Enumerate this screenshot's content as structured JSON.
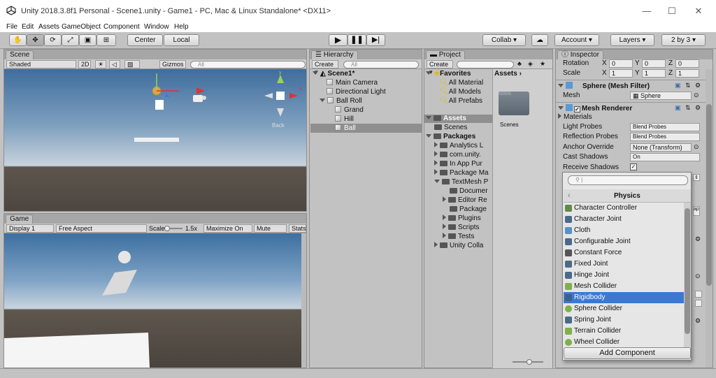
{
  "window": {
    "title": "Unity 2018.3.8f1 Personal - Scene1.unity - Game1 - PC, Mac & Linux Standalone* <DX11>",
    "minimize": "—",
    "maximize": "☐",
    "close": "✕"
  },
  "menu": [
    "File",
    "Edit",
    "Assets",
    "GameObject",
    "Component",
    "Window",
    "Help"
  ],
  "toolbar": {
    "center": "Center",
    "local": "Local",
    "collab": "Collab",
    "account": "Account",
    "layers": "Layers",
    "layout": "2 by 3"
  },
  "scene": {
    "tab": "Scene",
    "shading": "Shaded",
    "mode2d": "2D",
    "gizmos": "Gizmos",
    "search": "All",
    "back_label": "Back"
  },
  "game": {
    "tab": "Game",
    "display": "Display 1",
    "aspect": "Free Aspect",
    "scale_label": "Scale",
    "scale_value": "1.5x",
    "maximize": "Maximize On Play",
    "mute": "Mute Audio",
    "stats": "Stats"
  },
  "hierarchy": {
    "tab": "Hierarchy",
    "create": "Create",
    "search": "All",
    "scene": "Scene1*",
    "items": [
      "Main Camera",
      "Directional Light",
      "Ball Roll",
      "Grand",
      "Hill",
      "Ball"
    ]
  },
  "project": {
    "tab": "Project",
    "create": "Create",
    "favorites": "Favorites",
    "fav_items": [
      "All Material",
      "All Models",
      "All Prefabs"
    ],
    "assets": "Assets",
    "assets_children": [
      "Scenes"
    ],
    "packages": "Packages",
    "packages_children": [
      "Analytics L",
      "com.unity.",
      "In App Pur",
      "Package Ma",
      "TextMesh P"
    ],
    "textmesh_children": [
      "Documer",
      "Editor Re",
      "Package",
      "Plugins",
      "Scripts",
      "Tests"
    ],
    "unity_colla": "Unity Colla",
    "breadcrumb": "Assets",
    "folder_label": "Scenes"
  },
  "inspector": {
    "tab": "Inspector",
    "rotation": "Rotation",
    "scale": "Scale",
    "rot": {
      "x": "0",
      "y": "0",
      "z": "0"
    },
    "scl": {
      "x": "1",
      "y": "1",
      "z": "1"
    },
    "mesh_filter": "Sphere (Mesh Filter)",
    "mesh_label": "Mesh",
    "mesh_value": "Sphere",
    "mesh_renderer": "Mesh Renderer",
    "materials": "Materials",
    "rows": [
      {
        "label": "Light Probes",
        "value": "Blend Probes"
      },
      {
        "label": "Reflection Probes",
        "value": "Blend Probes"
      },
      {
        "label": "Anchor Override",
        "value": "None (Transform)"
      },
      {
        "label": "Cast Shadows",
        "value": "On"
      },
      {
        "label": "Receive Shadows",
        "value": ""
      }
    ],
    "add_component": "Add Component"
  },
  "popup": {
    "title": "Physics",
    "items": [
      "Character Controller",
      "Character Joint",
      "Cloth",
      "Configurable Joint",
      "Constant Force",
      "Fixed Joint",
      "Hinge Joint",
      "Mesh Collider",
      "Rigidbody",
      "Sphere Collider",
      "Spring Joint",
      "Terrain Collider",
      "Wheel Collider"
    ],
    "selected": "Rigidbody"
  },
  "colors": {
    "selection": "#3a78d4",
    "sky_top": "#3d6fa0",
    "ground": "#5b524a"
  }
}
